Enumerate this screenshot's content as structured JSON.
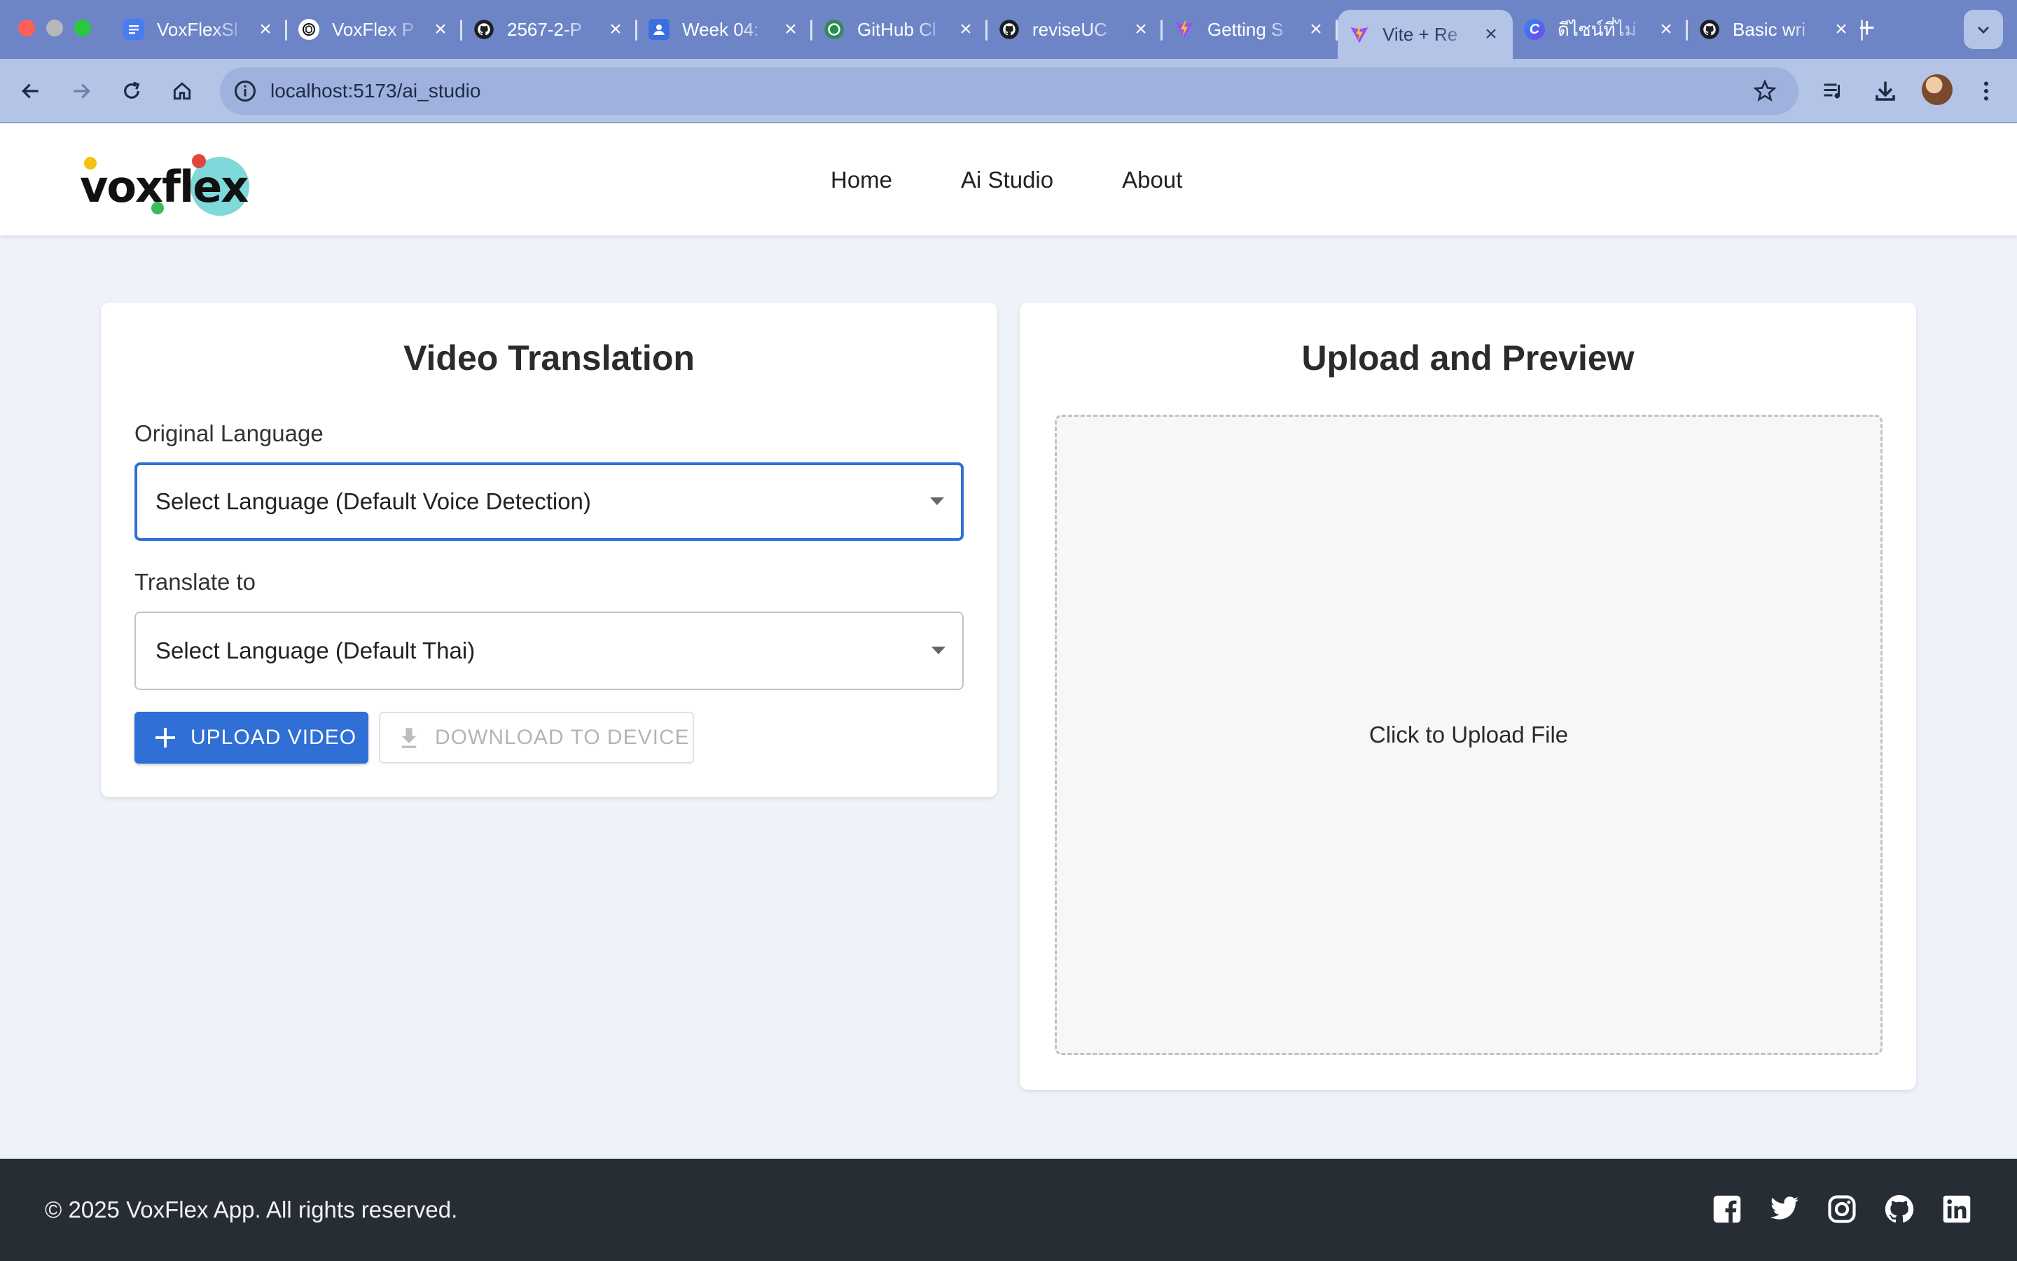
{
  "browser": {
    "tabs": [
      {
        "title": "VoxFlexSl",
        "favicon": "docs-icon",
        "color": "#4a7cf0"
      },
      {
        "title": "VoxFlex P",
        "favicon": "openai-icon",
        "color": "#ffffff"
      },
      {
        "title": "2567-2-P",
        "favicon": "github-icon",
        "color": "#1b1f24"
      },
      {
        "title": "Week 04:",
        "favicon": "classroom-icon",
        "color": "#3a6fe0"
      },
      {
        "title": "GitHub Cl",
        "favicon": "github-copilot-icon",
        "color": "#2e8b57"
      },
      {
        "title": "reviseUC",
        "favicon": "github-icon",
        "color": "#1b1f24"
      },
      {
        "title": "Getting S",
        "favicon": "vite-icon",
        "color": "#a34cf5"
      },
      {
        "title": "Vite + Re",
        "favicon": "vite-icon",
        "color": "#a34cf5",
        "active": true
      },
      {
        "title": "ดีไซน์ที่ไม่",
        "favicon": "canva-icon",
        "color": "#2a8cf0"
      },
      {
        "title": "Basic wri",
        "favicon": "github-icon",
        "color": "#1b1f24"
      }
    ],
    "url": "localhost:5173/ai_studio"
  },
  "header": {
    "logo_text": "voxflex",
    "nav": [
      "Home",
      "Ai Studio",
      "About"
    ]
  },
  "translation_card": {
    "title": "Video Translation",
    "original_language_label": "Original Language",
    "original_language_value": "Select Language (Default Voice Detection)",
    "translate_to_label": "Translate to",
    "translate_to_value": "Select Language (Default Thai)",
    "upload_button": "UPLOAD VIDEO",
    "download_button": "DOWNLOAD TO DEVICE"
  },
  "preview_card": {
    "title": "Upload and Preview",
    "dropzone_text": "Click to Upload File"
  },
  "footer": {
    "copyright": "© 2025 VoxFlex App. All rights reserved.",
    "socials": [
      "facebook-icon",
      "twitter-icon",
      "instagram-icon",
      "github-icon",
      "linkedin-icon"
    ]
  },
  "colors": {
    "accent": "#2f6fd6",
    "browser_frame": "#6d85c7",
    "footer_bg": "#272d35",
    "page_bg": "#eef2f9"
  }
}
